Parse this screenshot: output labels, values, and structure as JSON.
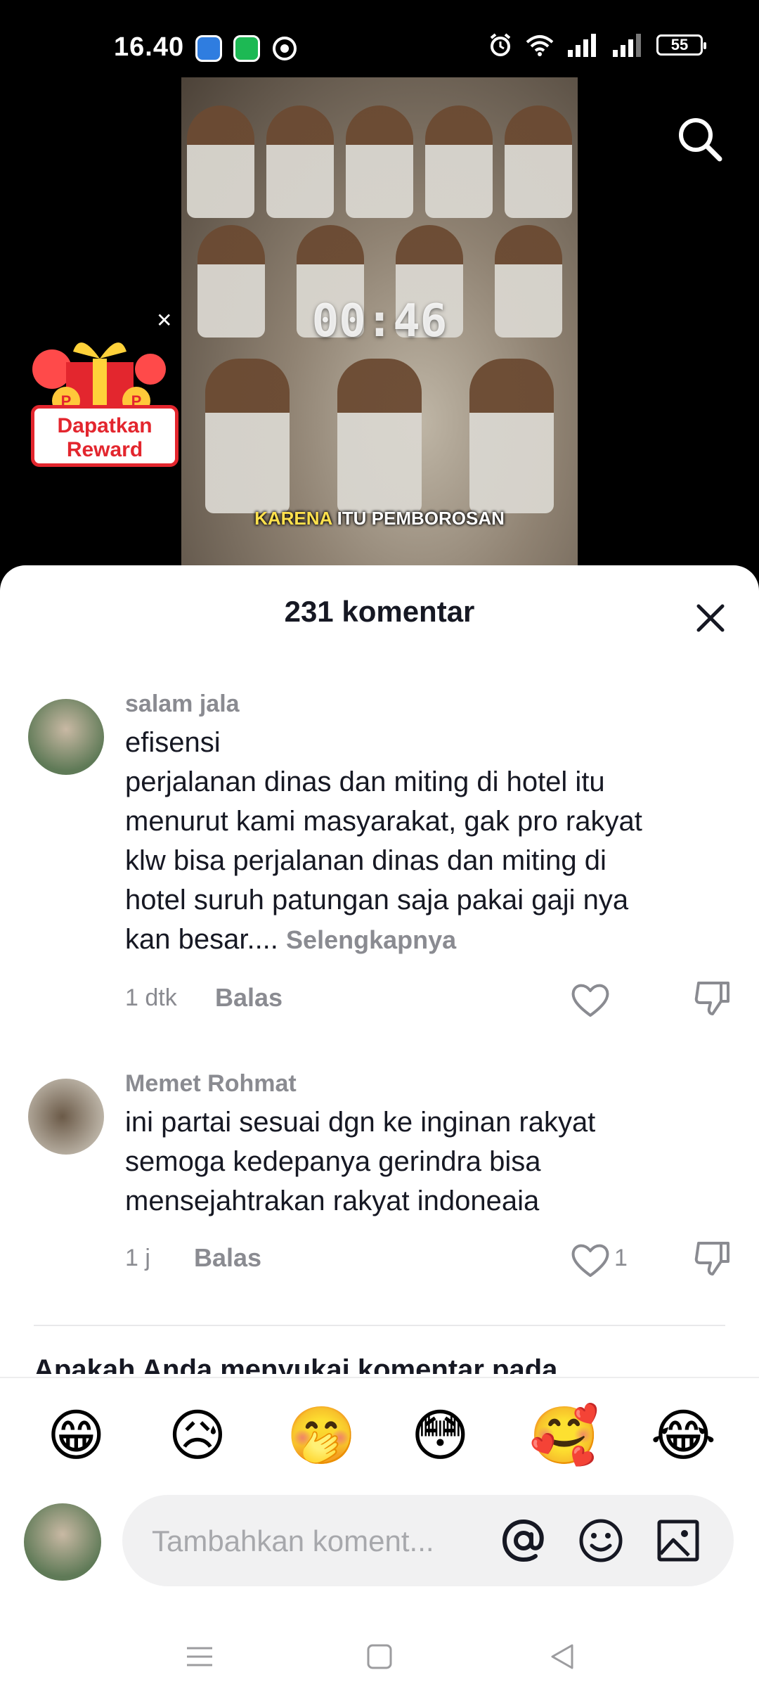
{
  "status_bar": {
    "time": "16.40",
    "battery": "55",
    "icons": [
      "app-notification-icon",
      "spotify-icon",
      "chrome-icon",
      "alarm-icon",
      "wifi-icon",
      "signal-icon",
      "signal-icon-2",
      "battery-icon"
    ]
  },
  "video": {
    "timer": "00:46",
    "caption_highlight": "KARENA",
    "caption_rest": " ITU PEMBOROSAN"
  },
  "reward": {
    "label_line1": "Dapatkan",
    "label_line2": "Reward"
  },
  "sheet": {
    "title": "231 komentar"
  },
  "comments": [
    {
      "user": "salam jala",
      "lines": [
        "efisensi",
        "perjalanan dinas dan miting di hotel itu",
        "menurut kami masyarakat, gak pro rakyat",
        "klw bisa perjalanan dinas dan miting di",
        "hotel suruh patungan saja pakai gaji nya",
        "kan besar...."
      ],
      "more": "Selengkapnya",
      "time": "1 dtk",
      "reply": "Balas",
      "likes": ""
    },
    {
      "user": "Memet Rohmat",
      "lines": [
        "ini partai sesuai dgn ke inginan rakyat",
        "semoga kedepanya gerindra bisa",
        "mensejahtrakan rakyat indoneaia"
      ],
      "time": "1 j",
      "reply": "Balas",
      "likes": "1"
    }
  ],
  "prompt": "Apakah Anda menyukai komentar pada",
  "emojis": [
    "😁",
    "😥",
    "🤭",
    "😳",
    "🥰",
    "😂"
  ],
  "input": {
    "placeholder": "Tambahkan koment..."
  },
  "colors": {
    "accent_red": "#e3262e",
    "text_primary": "#161823",
    "text_secondary": "#8a8b91"
  }
}
